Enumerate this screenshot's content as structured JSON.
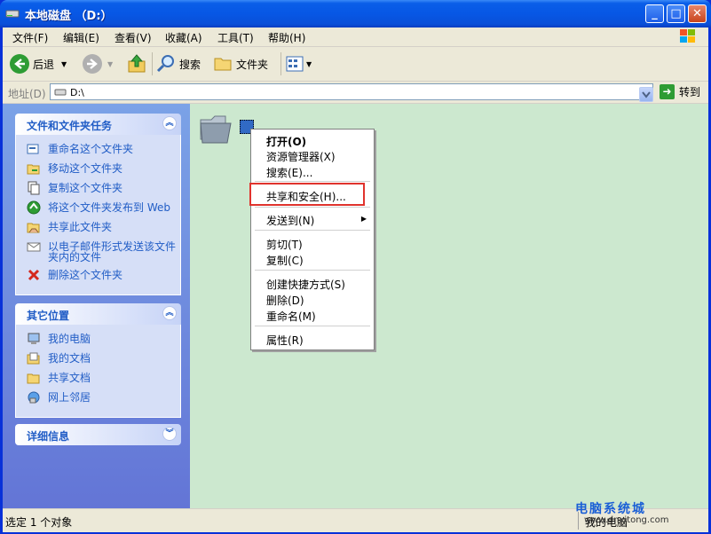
{
  "window": {
    "title": "本地磁盘 （D:）",
    "controls": [
      "_",
      "□",
      "✕"
    ]
  },
  "menubar": [
    "文件(F)",
    "编辑(E)",
    "查看(V)",
    "收藏(A)",
    "工具(T)",
    "帮助(H)"
  ],
  "toolbar": {
    "back": "后退",
    "search": "搜索",
    "folders": "文件夹"
  },
  "address": {
    "label": "地址(D)",
    "value": "D:\\",
    "go": "转到"
  },
  "tasks_panel": {
    "title": "文件和文件夹任务",
    "items": [
      "重命名这个文件夹",
      "移动这个文件夹",
      "复制这个文件夹",
      "将这个文件夹发布到 Web",
      "共享此文件夹",
      "以电子邮件形式发送该文件夹内的文件",
      "删除这个文件夹"
    ]
  },
  "places_panel": {
    "title": "其它位置",
    "items": [
      "我的电脑",
      "我的文档",
      "共享文档",
      "网上邻居"
    ]
  },
  "details_panel": {
    "title": "详细信息"
  },
  "context_menu": {
    "items": [
      "打开(O)",
      "资源管理器(X)",
      "搜索(E)...",
      "共享和安全(H)...",
      "发送到(N)",
      "剪切(T)",
      "复制(C)",
      "创建快捷方式(S)",
      "删除(D)",
      "重命名(M)",
      "属性(R)"
    ]
  },
  "status": {
    "left": "选定 1 个对象",
    "right": "我的电脑"
  },
  "watermark": {
    "line1": "电脑系统城",
    "line2": "www.dnxitong.com"
  },
  "colors": {
    "title_blue": "#0a5ee8",
    "task_blue": "#215dc6",
    "content_bg": "#cce8cf",
    "highlight": "#e0332d"
  }
}
